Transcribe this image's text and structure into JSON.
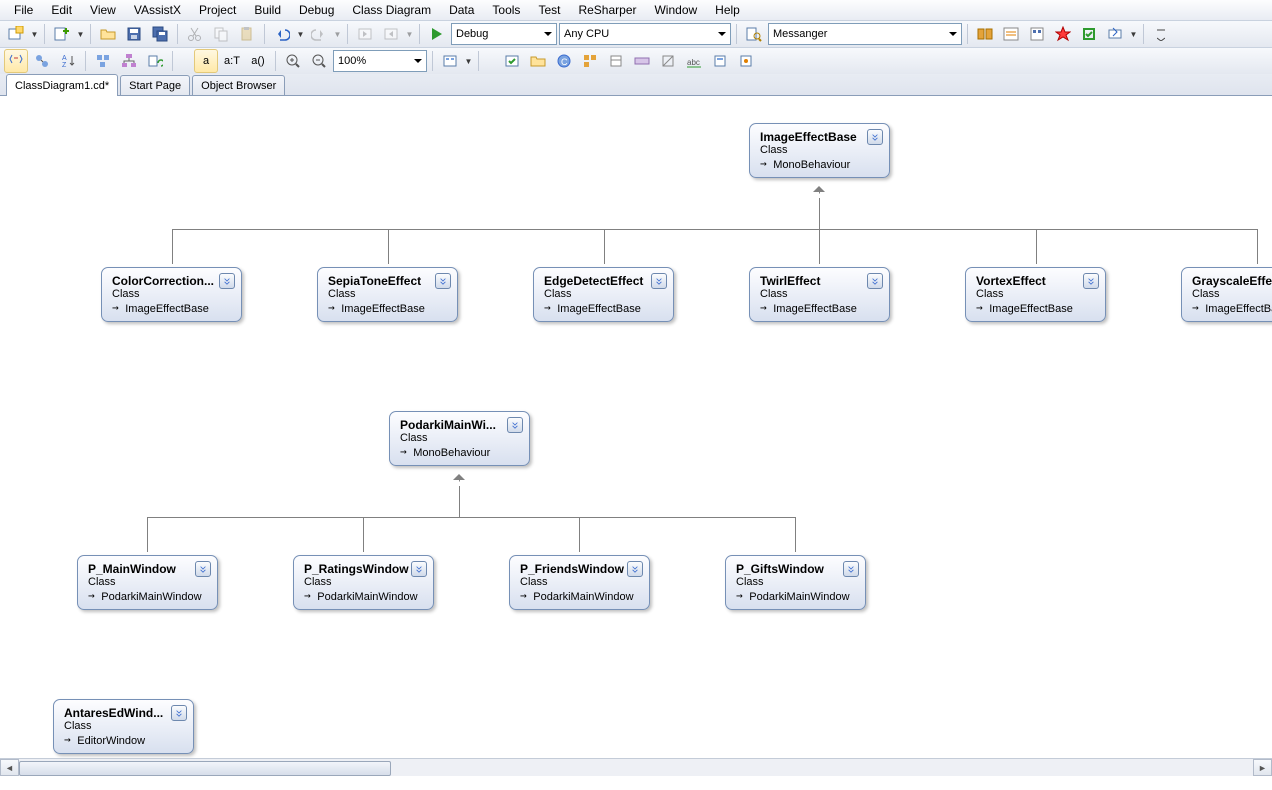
{
  "menu": [
    "File",
    "Edit",
    "View",
    "VAssistX",
    "Project",
    "Build",
    "Debug",
    "Class Diagram",
    "Data",
    "Tools",
    "Test",
    "ReSharper",
    "Window",
    "Help"
  ],
  "toolbar": {
    "config": "Debug",
    "platform": "Any CPU",
    "find": "Messanger",
    "zoom": "100%",
    "btnA": "a",
    "btnAT": "a:T",
    "btnAP": "a()"
  },
  "tabs": [
    {
      "label": "ClassDiagram1.cd*",
      "active": true
    },
    {
      "label": "Start Page",
      "active": false
    },
    {
      "label": "Object Browser",
      "active": false
    }
  ],
  "nodes": {
    "imageEffectBase": {
      "title": "ImageEffectBase",
      "sub": "Class",
      "inh": "MonoBehaviour"
    },
    "colorCorrection": {
      "title": "ColorCorrection...",
      "sub": "Class",
      "inh": "ImageEffectBase"
    },
    "sepia": {
      "title": "SepiaToneEffect",
      "sub": "Class",
      "inh": "ImageEffectBase"
    },
    "edge": {
      "title": "EdgeDetectEffect",
      "sub": "Class",
      "inh": "ImageEffectBase"
    },
    "twirl": {
      "title": "TwirlEffect",
      "sub": "Class",
      "inh": "ImageEffectBase"
    },
    "vortex": {
      "title": "VortexEffect",
      "sub": "Class",
      "inh": "ImageEffectBase"
    },
    "grayscale": {
      "title": "GrayscaleEffec",
      "sub": "Class",
      "inh": "ImageEffectBa"
    },
    "podarkiMain": {
      "title": "PodarkiMainWi...",
      "sub": "Class",
      "inh": "MonoBehaviour"
    },
    "pMain": {
      "title": "P_MainWindow",
      "sub": "Class",
      "inh": "PodarkiMainWindow"
    },
    "pRatings": {
      "title": "P_RatingsWindow",
      "sub": "Class",
      "inh": "PodarkiMainWindow"
    },
    "pFriends": {
      "title": "P_FriendsWindow",
      "sub": "Class",
      "inh": "PodarkiMainWindow"
    },
    "pGifts": {
      "title": "P_GiftsWindow",
      "sub": "Class",
      "inh": "PodarkiMainWindow"
    },
    "antares": {
      "title": "AntaresEdWind...",
      "sub": "Class",
      "inh": "EditorWindow"
    }
  }
}
